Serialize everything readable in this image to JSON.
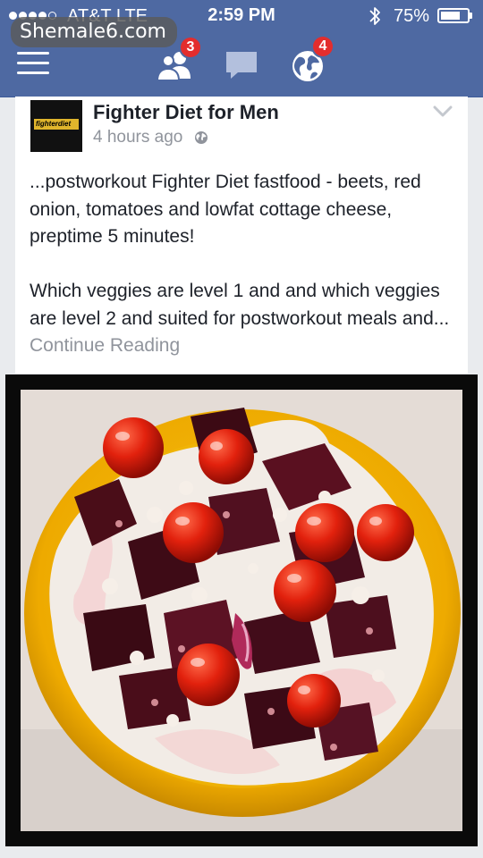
{
  "status_bar": {
    "carrier": "AT&T  LTE",
    "time": "2:59 PM",
    "battery_percent": "75%",
    "battery_level": 0.75,
    "signal_bars_filled": 4,
    "signal_bars_total": 5
  },
  "watermark": "Shemale6.com",
  "nav": {
    "friend_requests_count": "3",
    "notifications_count": "4"
  },
  "post": {
    "author": "Fighter Diet for Men",
    "timestamp": "4 hours ago",
    "logo_text": "fighterdiet",
    "paragraph_1": "...postworkout Fighter Diet fastfood - beets, red onion, tomatoes and lowfat cottage cheese, preptime 5 minutes!",
    "paragraph_2": "Which veggies are level 1 and and which veggies are level 2 and suited for postworkout meals and... ",
    "continue_label": "Continue Reading"
  },
  "colors": {
    "header_blue": "#4e69a2",
    "badge_red": "#e32d2d",
    "muted_text": "#90949c",
    "plate_yellow": "#f2b400"
  }
}
